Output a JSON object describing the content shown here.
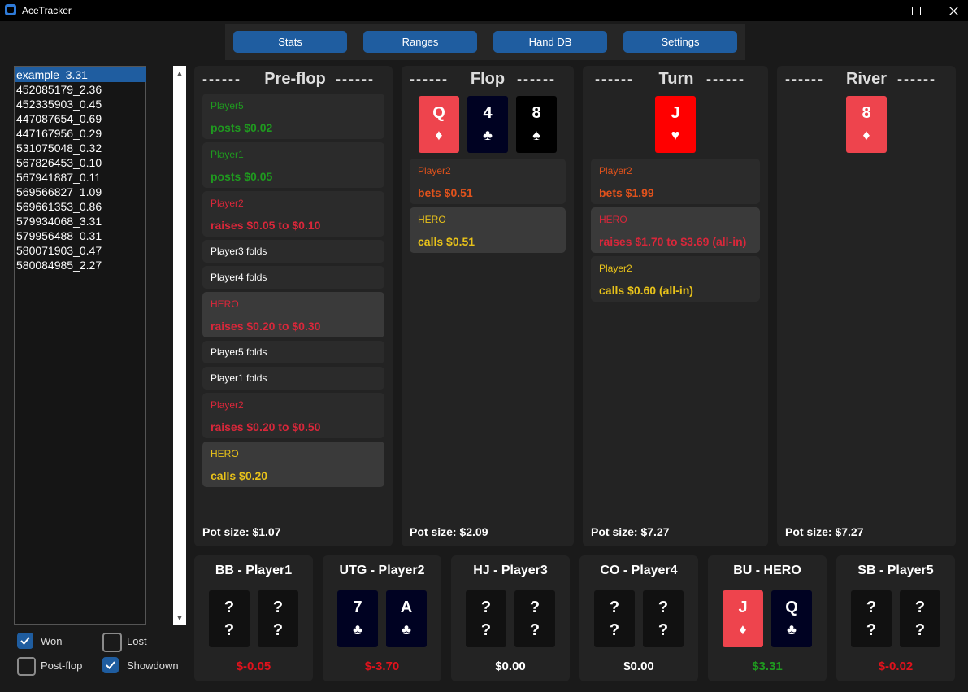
{
  "window": {
    "title": "AceTracker"
  },
  "nav": [
    "Stats",
    "Ranges",
    "Hand DB",
    "Settings"
  ],
  "hands": [
    "example_3.31",
    "452085179_2.36",
    "452335903_0.45",
    "447087654_0.69",
    "447167956_0.29",
    "531075048_0.32",
    "567826453_0.10",
    "567941887_0.11",
    "569566827_1.09",
    "569661353_0.86",
    "579934068_3.31",
    "579956488_0.31",
    "580071903_0.47",
    "580084985_2.27"
  ],
  "selected_hand": "example_3.31",
  "filters": [
    {
      "label": "Won",
      "checked": true
    },
    {
      "label": "Lost",
      "checked": false
    },
    {
      "label": "Post-flop",
      "checked": false
    },
    {
      "label": "Showdown",
      "checked": true
    }
  ],
  "streets": {
    "preflop": {
      "title": "Pre-flop",
      "actions": [
        {
          "who": "Player5",
          "what": "posts $0.02",
          "color": "#1f9a1f"
        },
        {
          "who": "Player1",
          "what": "posts $0.05",
          "color": "#1f9a1f"
        },
        {
          "who": "Player2",
          "what": "raises $0.05 to $0.10",
          "color": "#d9273a"
        },
        {
          "fold": "Player3 folds"
        },
        {
          "fold": "Player4 folds"
        },
        {
          "who": "HERO",
          "what": "raises $0.20 to $0.30",
          "color": "#d9273a"
        },
        {
          "fold": "Player5 folds"
        },
        {
          "fold": "Player1 folds"
        },
        {
          "who": "Player2",
          "what": "raises $0.20 to $0.50",
          "color": "#d9273a"
        },
        {
          "who": "HERO",
          "what": "calls $0.20",
          "color": "#e8c21a"
        }
      ],
      "pot": "Pot size: $1.07"
    },
    "flop": {
      "title": "Flop",
      "cards": [
        {
          "rank": "Q",
          "suit": "♦",
          "style": "red"
        },
        {
          "rank": "4",
          "suit": "♣",
          "style": "navy"
        },
        {
          "rank": "8",
          "suit": "♠",
          "style": "black"
        }
      ],
      "actions": [
        {
          "who": "Player2",
          "what": "bets $0.51",
          "color": "#e0521c"
        },
        {
          "who": "HERO",
          "what": "calls $0.51",
          "color": "#e8c21a"
        }
      ],
      "pot": "Pot size: $2.09"
    },
    "turn": {
      "title": "Turn",
      "cards": [
        {
          "rank": "J",
          "suit": "♥",
          "style": "bright"
        }
      ],
      "actions": [
        {
          "who": "Player2",
          "what": "bets $1.99",
          "color": "#e0521c"
        },
        {
          "who": "HERO",
          "what": "raises $1.70 to $3.69 (all-in)",
          "color": "#d9273a"
        },
        {
          "who": "Player2",
          "what": "calls $0.60 (all-in)",
          "color": "#e8c21a"
        }
      ],
      "pot": "Pot size: $7.27"
    },
    "river": {
      "title": "River",
      "cards": [
        {
          "rank": "8",
          "suit": "♦",
          "style": "red"
        }
      ],
      "pot": "Pot size: $7.27"
    }
  },
  "seats": [
    {
      "title": "BB - Player1",
      "cards": [
        [
          "?",
          "?"
        ],
        [
          "?",
          "?"
        ]
      ],
      "amount": "$-0.05",
      "amount_color": "red"
    },
    {
      "title": "UTG - Player2",
      "cards": [
        [
          "7",
          "♣"
        ],
        [
          "A",
          "♣"
        ]
      ],
      "amount": "$-3.70",
      "amount_color": "red"
    },
    {
      "title": "HJ - Player3",
      "cards": [
        [
          "?",
          "?"
        ],
        [
          "?",
          "?"
        ]
      ],
      "amount": "$0.00",
      "amount_color": "white"
    },
    {
      "title": "CO - Player4",
      "cards": [
        [
          "?",
          "?"
        ],
        [
          "?",
          "?"
        ]
      ],
      "amount": "$0.00",
      "amount_color": "white"
    },
    {
      "title": "BU - HERO",
      "cards": [
        [
          "J",
          "♦"
        ],
        [
          "Q",
          "♣"
        ]
      ],
      "amount": "$3.31",
      "amount_color": "green"
    },
    {
      "title": "SB - Player5",
      "cards": [
        [
          "?",
          "?"
        ],
        [
          "?",
          "?"
        ]
      ],
      "amount": "$-0.02",
      "amount_color": "red"
    }
  ]
}
